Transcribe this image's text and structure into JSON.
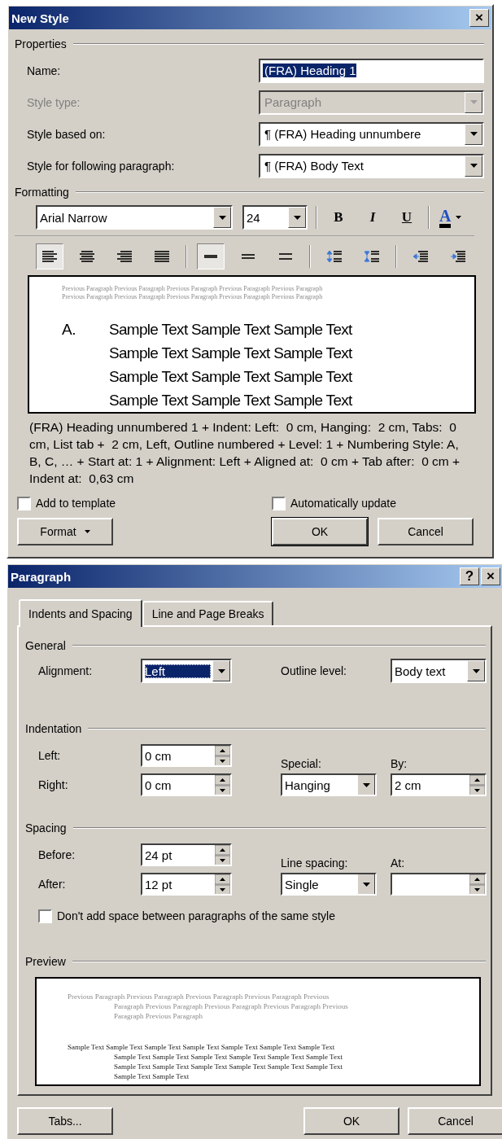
{
  "new_style": {
    "title": "New Style",
    "close": "×",
    "properties": {
      "heading": "Properties",
      "fields": [
        {
          "label": "Name:",
          "kind": "text",
          "value": "(FRA) Heading 1",
          "highlighted": true,
          "disabled": false
        },
        {
          "label": "Style type:",
          "kind": "dropdown",
          "value": "Paragraph",
          "highlighted": false,
          "disabled": true
        },
        {
          "label": "Style based on:",
          "kind": "dropdown",
          "value": "¶ (FRA) Heading unnumbere",
          "highlighted": false,
          "disabled": false
        },
        {
          "label": "Style for following paragraph:",
          "kind": "dropdown",
          "value": "¶ (FRA) Body Text",
          "highlighted": false,
          "disabled": false
        }
      ]
    },
    "formatting": {
      "heading": "Formatting",
      "font": "Arial Narrow",
      "size": "24",
      "style_buttons": [
        {
          "kind": "bold",
          "label": "B"
        },
        {
          "kind": "italic",
          "label": "I"
        },
        {
          "kind": "underline",
          "label": "U"
        }
      ],
      "font_color": "A",
      "tool_buttons": [
        {
          "kind": "align-left",
          "selected": true
        },
        {
          "kind": "align-center",
          "selected": false
        },
        {
          "kind": "align-right",
          "selected": false
        },
        {
          "kind": "justify",
          "selected": false
        },
        {
          "kind": "single-spacing",
          "selected": true
        },
        {
          "kind": "one-half-spacing",
          "selected": false
        },
        {
          "kind": "double-spacing",
          "selected": false
        },
        {
          "kind": "space-before",
          "selected": false
        },
        {
          "kind": "space-after",
          "selected": false
        },
        {
          "kind": "decrease-indent",
          "selected": false
        },
        {
          "kind": "increase-indent",
          "selected": false
        }
      ]
    },
    "preview": {
      "previous_lines": [
        "Previous Paragraph Previous Paragraph Previous Paragraph Previous Paragraph Previous Paragraph",
        "Previous Paragraph Previous Paragraph Previous Paragraph Previous Paragraph Previous Paragraph"
      ],
      "marker": "A.",
      "sample_lines": [
        "Sample Text Sample Text Sample Text",
        "Sample Text Sample Text Sample Text",
        "Sample Text Sample Text Sample Text",
        "Sample Text Sample Text Sample Text"
      ]
    },
    "description": "(FRA) Heading unnumbered 1 + Indent: Left:  0 cm, Hanging:  2 cm, Tabs:  0 cm, List tab +  2 cm, Left, Outline numbered + Level: 1 + Numbering Style: A, B, C, … + Start at: 1 + Alignment: Left + Aligned at:  0 cm + Tab after:  0 cm + Indent at:  0,63 cm",
    "checkboxes": [
      {
        "label": "Add to template",
        "checked": false
      },
      {
        "label": "Automatically update",
        "checked": false
      }
    ],
    "buttons": [
      {
        "label": "Format",
        "kind": "menu"
      },
      {
        "label": "OK",
        "kind": "default"
      },
      {
        "label": "Cancel",
        "kind": "plain"
      }
    ]
  },
  "paragraph": {
    "title": "Paragraph",
    "help": "?",
    "close": "×",
    "tabs": [
      {
        "label": "Indents and Spacing",
        "selected": true
      },
      {
        "label": "Line and Page Breaks",
        "selected": false
      }
    ],
    "general": {
      "heading": "General",
      "alignment": {
        "label": "Alignment:",
        "kind": "dropdown",
        "value": "Left",
        "highlighted": true
      },
      "outline_level": {
        "label": "Outline level:",
        "kind": "dropdown",
        "value": "Body text",
        "highlighted": false
      }
    },
    "indentation": {
      "heading": "Indentation",
      "left": {
        "label": "Left:",
        "kind": "spin",
        "value": "0 cm",
        "highlighted": false
      },
      "right": {
        "label": "Right:",
        "kind": "spin",
        "value": "0 cm",
        "highlighted": false
      },
      "special": {
        "label": "Special:",
        "kind": "dropdown",
        "value": "Hanging",
        "highlighted": false
      },
      "by": {
        "label": "By:",
        "kind": "spin",
        "value": "2 cm",
        "highlighted": false
      }
    },
    "spacing": {
      "heading": "Spacing",
      "before": {
        "label": "Before:",
        "kind": "spin",
        "value": "24 pt",
        "highlighted": false
      },
      "after": {
        "label": "After:",
        "kind": "spin",
        "value": "12 pt",
        "highlighted": false
      },
      "line_spacing": {
        "label": "Line spacing:",
        "kind": "dropdown",
        "value": "Single",
        "highlighted": false
      },
      "at": {
        "label": "At:",
        "kind": "spin"
      }
    },
    "same_style_checkbox": {
      "label": "Don't add space between paragraphs of the same style",
      "checked": false
    },
    "preview": {
      "heading": "Preview",
      "previous_lines": [
        "Previous Paragraph Previous Paragraph Previous Paragraph Previous Paragraph Previous",
        "Paragraph Previous Paragraph Previous Paragraph Previous Paragraph Previous",
        "Paragraph Previous Paragraph"
      ],
      "sample_lines": [
        "Sample Text Sample Text Sample Text Sample Text Sample Text Sample Text Sample Text",
        "Sample Text Sample Text Sample Text Sample Text Sample Text Sample Text",
        "Sample Text Sample Text Sample Text Sample Text Sample Text Sample Text",
        "Sample Text Sample Text"
      ]
    },
    "buttons": [
      "Tabs...",
      "OK",
      "Cancel"
    ]
  }
}
